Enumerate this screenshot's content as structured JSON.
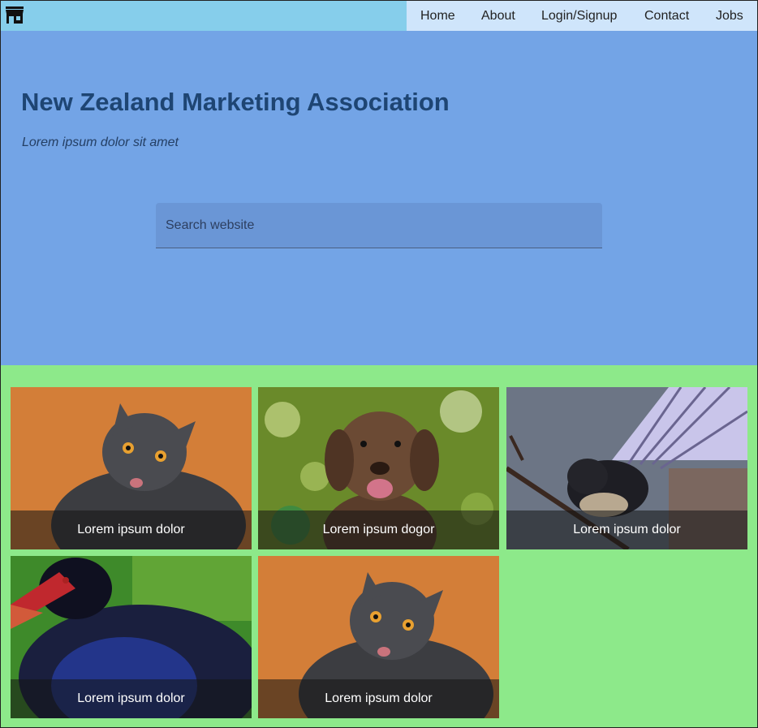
{
  "topbar": {
    "logo_icon": "storefront-icon",
    "nav": [
      {
        "label": "Home"
      },
      {
        "label": "About"
      },
      {
        "label": "Login/Signup"
      },
      {
        "label": "Contact"
      },
      {
        "label": "Jobs"
      }
    ]
  },
  "hero": {
    "title": "New Zealand Marketing Association",
    "subtitle": "Lorem ipsum dolor sit amet",
    "search_placeholder": "Search website"
  },
  "gallery": {
    "cards": [
      {
        "caption": "Lorem ipsum dolor",
        "image": "cat"
      },
      {
        "caption": "Lorem ipsum dogor",
        "image": "puppy"
      },
      {
        "caption": "Lorem ipsum dolor",
        "image": "fantail-bird"
      },
      {
        "caption": "Lorem ipsum dolor",
        "image": "pukeko-bird"
      },
      {
        "caption": "Lorem ipsum dolor",
        "image": "cat"
      }
    ]
  },
  "colors": {
    "topbar": "#86ceeb",
    "nav": "#cfe5fb",
    "hero": "#73a4e6",
    "title": "#1e4573",
    "gallery_bg": "#8de98a"
  }
}
